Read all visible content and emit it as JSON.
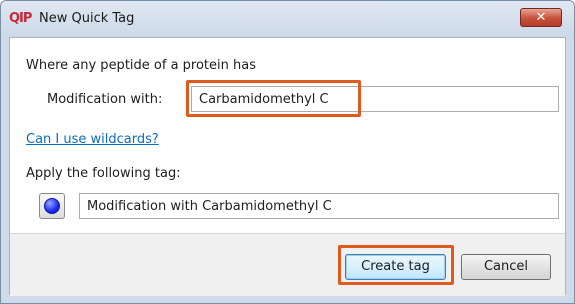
{
  "window": {
    "logo": "QIP",
    "title": "New Quick Tag",
    "close_label": "✕"
  },
  "form": {
    "heading": "Where any peptide of a protein has",
    "modification_label": "Modification with:",
    "modification_value": "Carbamidomethyl C",
    "wildcards_link": "Can I use wildcards?",
    "apply_label": "Apply the following tag:",
    "tag_color": "#1c2af0",
    "tag_value": "Modification with Carbamidomethyl C"
  },
  "buttons": {
    "create": "Create tag",
    "cancel": "Cancel"
  },
  "highlight_color": "#e05a1e"
}
